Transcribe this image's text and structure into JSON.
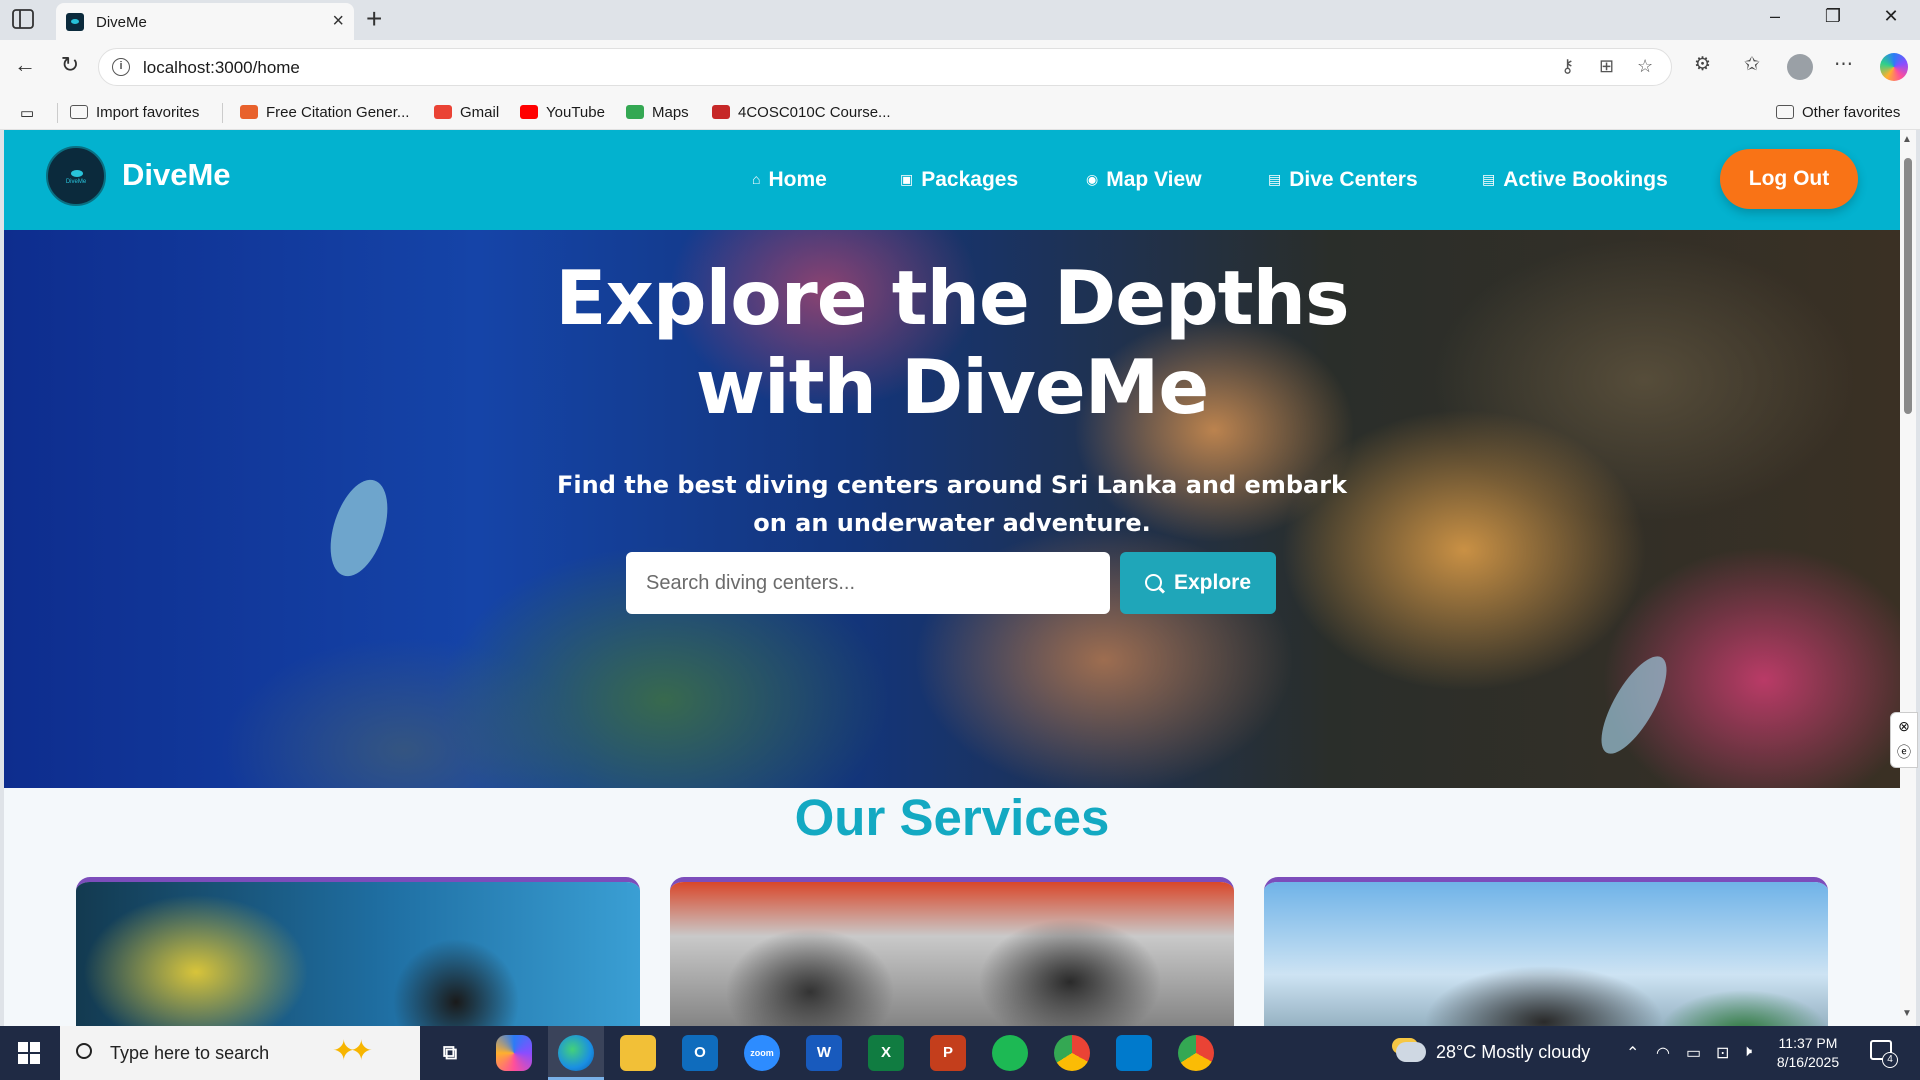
{
  "browser": {
    "tab_title": "DiveMe",
    "url": "localhost:3000/home",
    "favorites": [
      {
        "label": "Import favorites",
        "color": "#555555"
      },
      {
        "label": "Free Citation Gener...",
        "color": "#e8612c"
      },
      {
        "label": "Gmail",
        "color": "#ea4335"
      },
      {
        "label": "YouTube",
        "color": "#ff0000"
      },
      {
        "label": "Maps",
        "color": "#34a853"
      },
      {
        "label": "4COSC010C Course...",
        "color": "#c62828"
      }
    ],
    "other_favorites": "Other favorites"
  },
  "site": {
    "brand": "DiveMe",
    "logo_text": "DiveMe",
    "nav": [
      {
        "label": "Home",
        "icon": "home-icon"
      },
      {
        "label": "Packages",
        "icon": "package-icon"
      },
      {
        "label": "Map View",
        "icon": "map-pin-icon"
      },
      {
        "label": "Dive Centers",
        "icon": "document-icon"
      },
      {
        "label": "Active Bookings",
        "icon": "document-icon"
      }
    ],
    "logout_label": "Log Out",
    "colors": {
      "nav_bg": "#03b2cf",
      "logout": "#f97316",
      "accent": "#13a9c2",
      "explore": "#1fa6b9"
    }
  },
  "hero": {
    "title_line1": "Explore the Depths",
    "title_line2": "with DiveMe",
    "subtitle": "Find the best diving centers around Sri Lanka and embark on an underwater adventure.",
    "search_placeholder": "Search diving centers...",
    "explore_label": "Explore"
  },
  "services": {
    "title": "Our Services"
  },
  "taskbar": {
    "search_placeholder": "Type here to search",
    "weather": "28°C  Mostly cloudy",
    "time": "11:37 PM",
    "date": "8/16/2025",
    "notification_count": "4",
    "apps": [
      {
        "name": "copilot-app",
        "label": ""
      },
      {
        "name": "edge-app",
        "label": ""
      },
      {
        "name": "file-explorer-app",
        "label": ""
      },
      {
        "name": "outlook-app",
        "label": "O"
      },
      {
        "name": "zoom-app",
        "label": "zoom"
      },
      {
        "name": "word-app",
        "label": "W"
      },
      {
        "name": "excel-app",
        "label": "X"
      },
      {
        "name": "powerpoint-app",
        "label": "P"
      },
      {
        "name": "spotify-app",
        "label": ""
      },
      {
        "name": "chrome-app",
        "label": ""
      },
      {
        "name": "vscode-app",
        "label": ""
      },
      {
        "name": "chrome-profile-app",
        "label": ""
      }
    ]
  }
}
